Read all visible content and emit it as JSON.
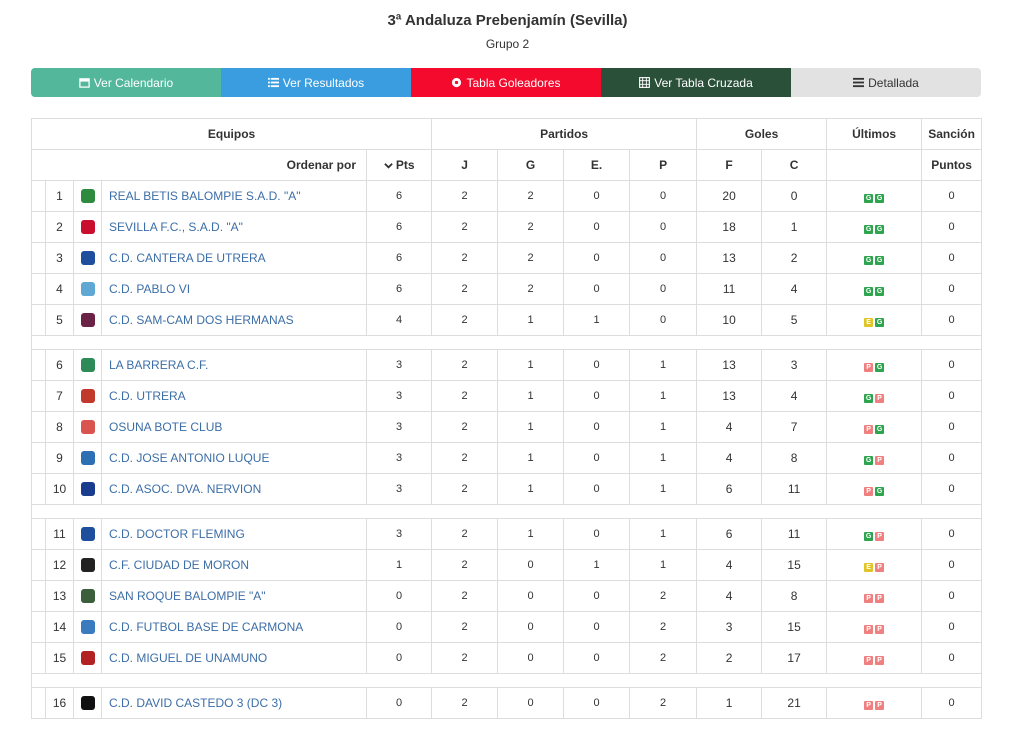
{
  "header": {
    "title": "3ª Andaluza Prebenjamín (Sevilla)",
    "subtitle": "Grupo 2"
  },
  "buttons": [
    {
      "label": "Ver Calendario",
      "icon": "calendar-icon",
      "color": "#52b79b"
    },
    {
      "label": "Ver Resultados",
      "icon": "list-icon",
      "color": "#3a9de0"
    },
    {
      "label": "Tabla Goleadores",
      "icon": "soccer-ball-icon",
      "color": "#f30a2c"
    },
    {
      "label": "Ver Tabla Cruzada",
      "icon": "table-icon",
      "color": "#2a5039"
    },
    {
      "label": "Detallada",
      "icon": "detail-list-icon",
      "color": "#e2e2e2"
    }
  ],
  "table": {
    "group_headers": {
      "equipos": "Equipos",
      "partidos": "Partidos",
      "goles": "Goles",
      "ultimos": "Últimos",
      "sancion": "Sanción"
    },
    "sub_headers": {
      "ordenar": "Ordenar por",
      "pts": "Pts",
      "j": "J",
      "g": "G",
      "e": "E.",
      "p": "P",
      "f": "F",
      "c": "C",
      "puntos": "Puntos"
    },
    "rows": [
      {
        "pos": "1",
        "team": "REAL BETIS BALOMPIE S.A.D. \"A\"",
        "pts": "6",
        "j": "2",
        "g": "2",
        "e": "0",
        "p": "0",
        "f": "20",
        "c": "0",
        "last": [
          "G",
          "G"
        ],
        "sancion": "0",
        "crest": "#2e8b3e"
      },
      {
        "pos": "2",
        "team": "SEVILLA F.C., S.A.D. \"A\"",
        "pts": "6",
        "j": "2",
        "g": "2",
        "e": "0",
        "p": "0",
        "f": "18",
        "c": "1",
        "last": [
          "G",
          "G"
        ],
        "sancion": "0",
        "crest": "#c8102e"
      },
      {
        "pos": "3",
        "team": "C.D. CANTERA DE UTRERA",
        "pts": "6",
        "j": "2",
        "g": "2",
        "e": "0",
        "p": "0",
        "f": "13",
        "c": "2",
        "last": [
          "G",
          "G"
        ],
        "sancion": "0",
        "crest": "#1f4e9c"
      },
      {
        "pos": "4",
        "team": "C.D. PABLO VI",
        "pts": "6",
        "j": "2",
        "g": "2",
        "e": "0",
        "p": "0",
        "f": "11",
        "c": "4",
        "last": [
          "G",
          "G"
        ],
        "sancion": "0",
        "crest": "#5fa8d3"
      },
      {
        "pos": "5",
        "team": "C.D. SAM-CAM DOS HERMANAS",
        "pts": "4",
        "j": "2",
        "g": "1",
        "e": "1",
        "p": "0",
        "f": "10",
        "c": "5",
        "last": [
          "E",
          "G"
        ],
        "sancion": "0",
        "crest": "#6b2247"
      },
      {
        "pos": "6",
        "team": "LA BARRERA C.F.",
        "pts": "3",
        "j": "2",
        "g": "1",
        "e": "0",
        "p": "1",
        "f": "13",
        "c": "3",
        "last": [
          "P",
          "G"
        ],
        "sancion": "0",
        "crest": "#2e8b57"
      },
      {
        "pos": "7",
        "team": "C.D. UTRERA",
        "pts": "3",
        "j": "2",
        "g": "1",
        "e": "0",
        "p": "1",
        "f": "13",
        "c": "4",
        "last": [
          "G",
          "P"
        ],
        "sancion": "0",
        "crest": "#c0392b"
      },
      {
        "pos": "8",
        "team": "OSUNA BOTE CLUB",
        "pts": "3",
        "j": "2",
        "g": "1",
        "e": "0",
        "p": "1",
        "f": "4",
        "c": "7",
        "last": [
          "P",
          "G"
        ],
        "sancion": "0",
        "crest": "#d9534f"
      },
      {
        "pos": "9",
        "team": "C.D. JOSE ANTONIO LUQUE",
        "pts": "3",
        "j": "2",
        "g": "1",
        "e": "0",
        "p": "1",
        "f": "4",
        "c": "8",
        "last": [
          "G",
          "P"
        ],
        "sancion": "0",
        "crest": "#2c6fb3"
      },
      {
        "pos": "10",
        "team": "C.D. ASOC. DVA. NERVION",
        "pts": "3",
        "j": "2",
        "g": "1",
        "e": "0",
        "p": "1",
        "f": "6",
        "c": "11",
        "last": [
          "P",
          "G"
        ],
        "sancion": "0",
        "crest": "#1a3c8f"
      },
      {
        "pos": "11",
        "team": "C.D. DOCTOR FLEMING",
        "pts": "3",
        "j": "2",
        "g": "1",
        "e": "0",
        "p": "1",
        "f": "6",
        "c": "11",
        "last": [
          "G",
          "P"
        ],
        "sancion": "0",
        "crest": "#1f4e9c"
      },
      {
        "pos": "12",
        "team": "C.F. CIUDAD DE MORON",
        "pts": "1",
        "j": "2",
        "g": "0",
        "e": "1",
        "p": "1",
        "f": "4",
        "c": "15",
        "last": [
          "E",
          "P"
        ],
        "sancion": "0",
        "crest": "#222222"
      },
      {
        "pos": "13",
        "team": "SAN ROQUE BALOMPIE \"A\"",
        "pts": "0",
        "j": "2",
        "g": "0",
        "e": "0",
        "p": "2",
        "f": "4",
        "c": "8",
        "last": [
          "P",
          "P"
        ],
        "sancion": "0",
        "crest": "#3a5f3a"
      },
      {
        "pos": "14",
        "team": "C.D. FUTBOL BASE DE CARMONA",
        "pts": "0",
        "j": "2",
        "g": "0",
        "e": "0",
        "p": "2",
        "f": "3",
        "c": "15",
        "last": [
          "P",
          "P"
        ],
        "sancion": "0",
        "crest": "#3a7bbf"
      },
      {
        "pos": "15",
        "team": "C.D. MIGUEL DE UNAMUNO",
        "pts": "0",
        "j": "2",
        "g": "0",
        "e": "0",
        "p": "2",
        "f": "2",
        "c": "17",
        "last": [
          "P",
          "P"
        ],
        "sancion": "0",
        "crest": "#b22222"
      },
      {
        "pos": "16",
        "team": "C.D. DAVID CASTEDO 3 (DC 3)",
        "pts": "0",
        "j": "2",
        "g": "0",
        "e": "0",
        "p": "2",
        "f": "1",
        "c": "21",
        "last": [
          "P",
          "P"
        ],
        "sancion": "0",
        "crest": "#111111"
      }
    ],
    "gap_after": [
      5,
      10,
      15
    ]
  },
  "colors": {
    "win": "#2ea44f",
    "loss": "#f08080",
    "draw": "#e0c528",
    "link": "#3c6ea7"
  }
}
